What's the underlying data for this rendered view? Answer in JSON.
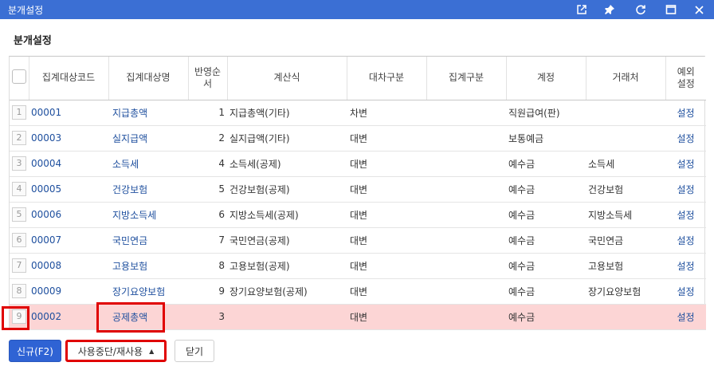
{
  "window": {
    "title": "분개설정"
  },
  "page": {
    "title": "분개설정"
  },
  "grid": {
    "columns": [
      "집계대상코드",
      "집계대상명",
      "반영순서",
      "계산식",
      "대차구분",
      "집계구분",
      "계정",
      "거래처",
      "예외설정"
    ],
    "rows": [
      {
        "num": "1",
        "code": "00001",
        "name": "지급총액",
        "order": "1",
        "formula": "지급총액(기타)",
        "dc": "차변",
        "agg": "",
        "account": "직원급여(판)",
        "partner": "",
        "setting": "설정"
      },
      {
        "num": "2",
        "code": "00003",
        "name": "실지급액",
        "order": "2",
        "formula": "실지급액(기타)",
        "dc": "대변",
        "agg": "",
        "account": "보통예금",
        "partner": "",
        "setting": "설정"
      },
      {
        "num": "3",
        "code": "00004",
        "name": "소득세",
        "order": "4",
        "formula": "소득세(공제)",
        "dc": "대변",
        "agg": "",
        "account": "예수금",
        "partner": "소득세",
        "setting": "설정"
      },
      {
        "num": "4",
        "code": "00005",
        "name": "건강보험",
        "order": "5",
        "formula": "건강보험(공제)",
        "dc": "대변",
        "agg": "",
        "account": "예수금",
        "partner": "건강보험",
        "setting": "설정"
      },
      {
        "num": "5",
        "code": "00006",
        "name": "지방소득세",
        "order": "6",
        "formula": "지방소득세(공제)",
        "dc": "대변",
        "agg": "",
        "account": "예수금",
        "partner": "지방소득세",
        "setting": "설정"
      },
      {
        "num": "6",
        "code": "00007",
        "name": "국민연금",
        "order": "7",
        "formula": "국민연금(공제)",
        "dc": "대변",
        "agg": "",
        "account": "예수금",
        "partner": "국민연금",
        "setting": "설정"
      },
      {
        "num": "7",
        "code": "00008",
        "name": "고용보험",
        "order": "8",
        "formula": "고용보험(공제)",
        "dc": "대변",
        "agg": "",
        "account": "예수금",
        "partner": "고용보험",
        "setting": "설정"
      },
      {
        "num": "8",
        "code": "00009",
        "name": "장기요양보험",
        "order": "9",
        "formula": "장기요양보험(공제)",
        "dc": "대변",
        "agg": "",
        "account": "예수금",
        "partner": "장기요양보험",
        "setting": "설정"
      },
      {
        "num": "9",
        "code": "00002",
        "name": "공제총액",
        "order": "3",
        "formula": "",
        "dc": "대변",
        "agg": "",
        "account": "예수금",
        "partner": "",
        "setting": "설정"
      }
    ]
  },
  "buttons": {
    "new": "신규(F2)",
    "stop": "사용중단/재사용",
    "close": "닫기"
  },
  "colors": {
    "titlebar": "#3b6fd4",
    "primary": "#2f63d4",
    "link": "#1e4f9e",
    "selected_row": "#fcd5d5",
    "highlight": "#e00000"
  },
  "icons": [
    "external-link-icon",
    "pin-icon",
    "refresh-icon",
    "maximize-icon",
    "close-icon"
  ]
}
